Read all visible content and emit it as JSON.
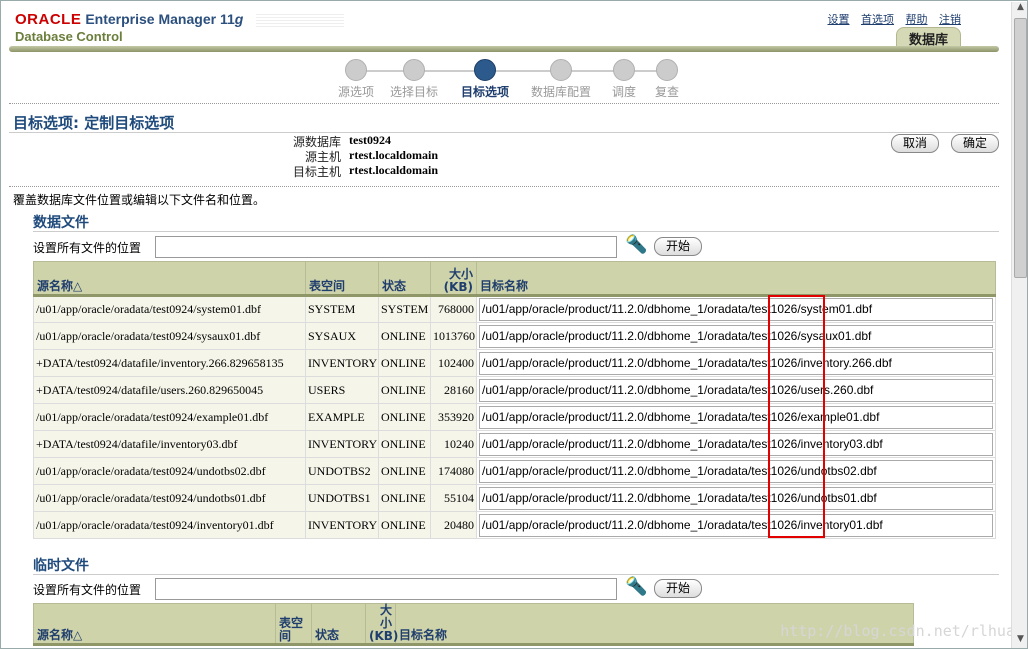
{
  "header": {
    "brand": "ORACLE",
    "product": "Enterprise Manager 11",
    "product_g": "g",
    "subtitle": "Database Control",
    "links": [
      "设置",
      "首选项",
      "帮助",
      "注销"
    ],
    "tab": "数据库"
  },
  "train": {
    "steps": [
      "源选项",
      "选择目标",
      "目标选项",
      "数据库配置",
      "调度",
      "复查"
    ],
    "active_index": 2
  },
  "page": {
    "title": "目标选项: 定制目标选项",
    "info": [
      {
        "label": "源数据库",
        "value": "test0924"
      },
      {
        "label": "源主机",
        "value": "rtest.localdomain"
      },
      {
        "label": "目标主机",
        "value": "rtest.localdomain"
      }
    ],
    "cancel": "取消",
    "ok": "确定",
    "instruction": "覆盖数据库文件位置或编辑以下文件名和位置。"
  },
  "datafiles": {
    "section": "数据文件",
    "setall_label": "设置所有文件的位置",
    "go": "开始",
    "columns": {
      "src": "源名称△",
      "ts": "表空间",
      "status": "状态",
      "size": "大小",
      "size_unit": "(KB)",
      "target": "目标名称"
    },
    "rows": [
      {
        "src": "/u01/app/oracle/oradata/test0924/system01.dbf",
        "ts": "SYSTEM",
        "status": "SYSTEM",
        "size": "768000",
        "target": "/u01/app/oracle/product/11.2.0/dbhome_1/oradata/test1026/system01.dbf"
      },
      {
        "src": "/u01/app/oracle/oradata/test0924/sysaux01.dbf",
        "ts": "SYSAUX",
        "status": "ONLINE",
        "size": "1013760",
        "target": "/u01/app/oracle/product/11.2.0/dbhome_1/oradata/test1026/sysaux01.dbf"
      },
      {
        "src": "+DATA/test0924/datafile/inventory.266.829658135",
        "ts": "INVENTORY",
        "status": "ONLINE",
        "size": "102400",
        "target": "/u01/app/oracle/product/11.2.0/dbhome_1/oradata/test1026/inventory.266.dbf"
      },
      {
        "src": "+DATA/test0924/datafile/users.260.829650045",
        "ts": "USERS",
        "status": "ONLINE",
        "size": "28160",
        "target": "/u01/app/oracle/product/11.2.0/dbhome_1/oradata/test1026/users.260.dbf"
      },
      {
        "src": "/u01/app/oracle/oradata/test0924/example01.dbf",
        "ts": "EXAMPLE",
        "status": "ONLINE",
        "size": "353920",
        "target": "/u01/app/oracle/product/11.2.0/dbhome_1/oradata/test1026/example01.dbf"
      },
      {
        "src": "+DATA/test0924/datafile/inventory03.dbf",
        "ts": "INVENTORY",
        "status": "ONLINE",
        "size": "10240",
        "target": "/u01/app/oracle/product/11.2.0/dbhome_1/oradata/test1026/inventory03.dbf"
      },
      {
        "src": "/u01/app/oracle/oradata/test0924/undotbs02.dbf",
        "ts": "UNDOTBS2",
        "status": "ONLINE",
        "size": "174080",
        "target": "/u01/app/oracle/product/11.2.0/dbhome_1/oradata/test1026/undotbs02.dbf"
      },
      {
        "src": "/u01/app/oracle/oradata/test0924/undotbs01.dbf",
        "ts": "UNDOTBS1",
        "status": "ONLINE",
        "size": "55104",
        "target": "/u01/app/oracle/product/11.2.0/dbhome_1/oradata/test1026/undotbs01.dbf"
      },
      {
        "src": "/u01/app/oracle/oradata/test0924/inventory01.dbf",
        "ts": "INVENTORY",
        "status": "ONLINE",
        "size": "20480",
        "target": "/u01/app/oracle/product/11.2.0/dbhome_1/oradata/test1026/inventory01.dbf"
      }
    ]
  },
  "tempfiles": {
    "section": "临时文件",
    "setall_label": "设置所有文件的位置",
    "go": "开始",
    "columns": {
      "src": "源名称△",
      "ts": "表空间",
      "status": "状态",
      "size": "大小",
      "size_unit": "(KB)",
      "target": "目标名称"
    }
  },
  "watermark": "http://blog.csdn.net/rlhua",
  "colors": {
    "header_bg": "#cfd3aa",
    "title": "#1f4a7c",
    "highlight": "#e00000",
    "brand": "#cc0000"
  }
}
